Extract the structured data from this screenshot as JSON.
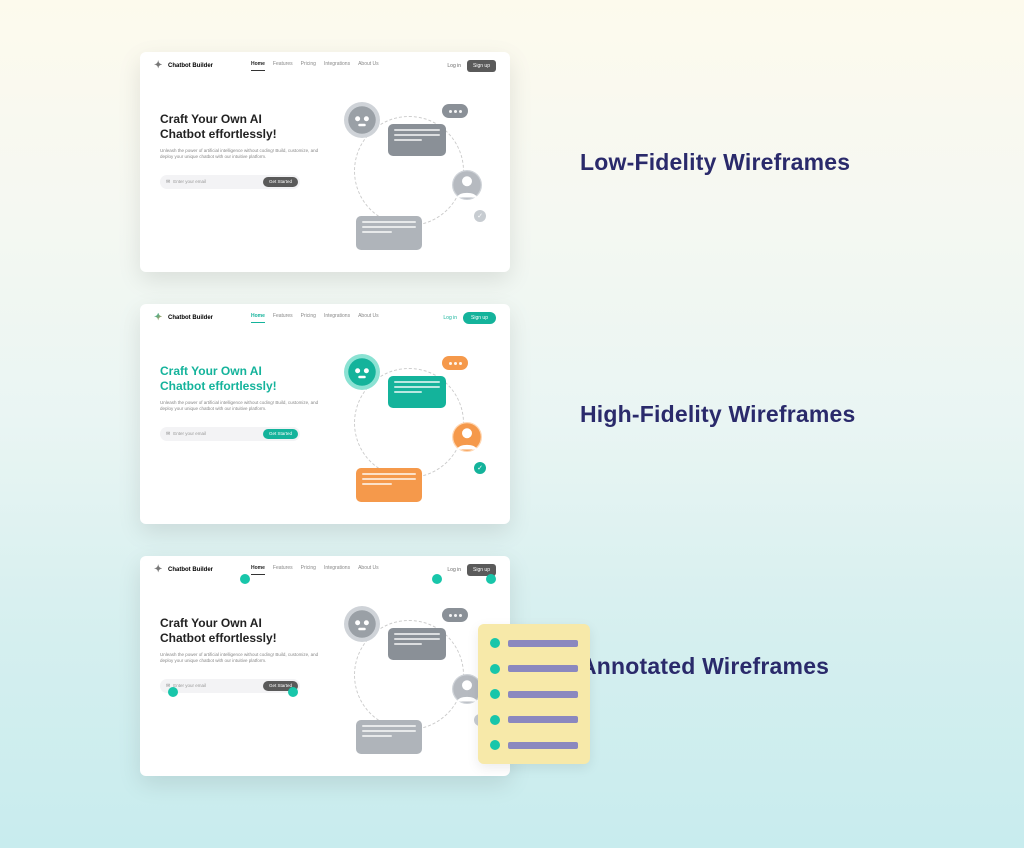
{
  "labels": {
    "lofi": "Low-Fidelity Wireframes",
    "hifi": "High-Fidelity Wireframes",
    "annotated": "Annotated Wireframes"
  },
  "mock": {
    "brand": "Chatbot Builder",
    "nav": [
      "Home",
      "Features",
      "Pricing",
      "Integrations",
      "About Us"
    ],
    "login": "Log in",
    "signup": "Sign up",
    "hero_title_1": "Craft Your Own AI",
    "hero_title_2": "Chatbot effortlessly!",
    "hero_sub": "Unleash the power of artificial intelligence without coding! Build, customize, and deploy your unique chatbot with our intuitive platform.",
    "email_placeholder": "Enter your email",
    "cta": "Get Started"
  },
  "colors": {
    "teal": "#14b39b",
    "orange": "#f5994b",
    "gray_avatar": "#9aa0a6",
    "gray_bubble": "#8a9097",
    "gray_bubble2": "#afb4ba"
  }
}
